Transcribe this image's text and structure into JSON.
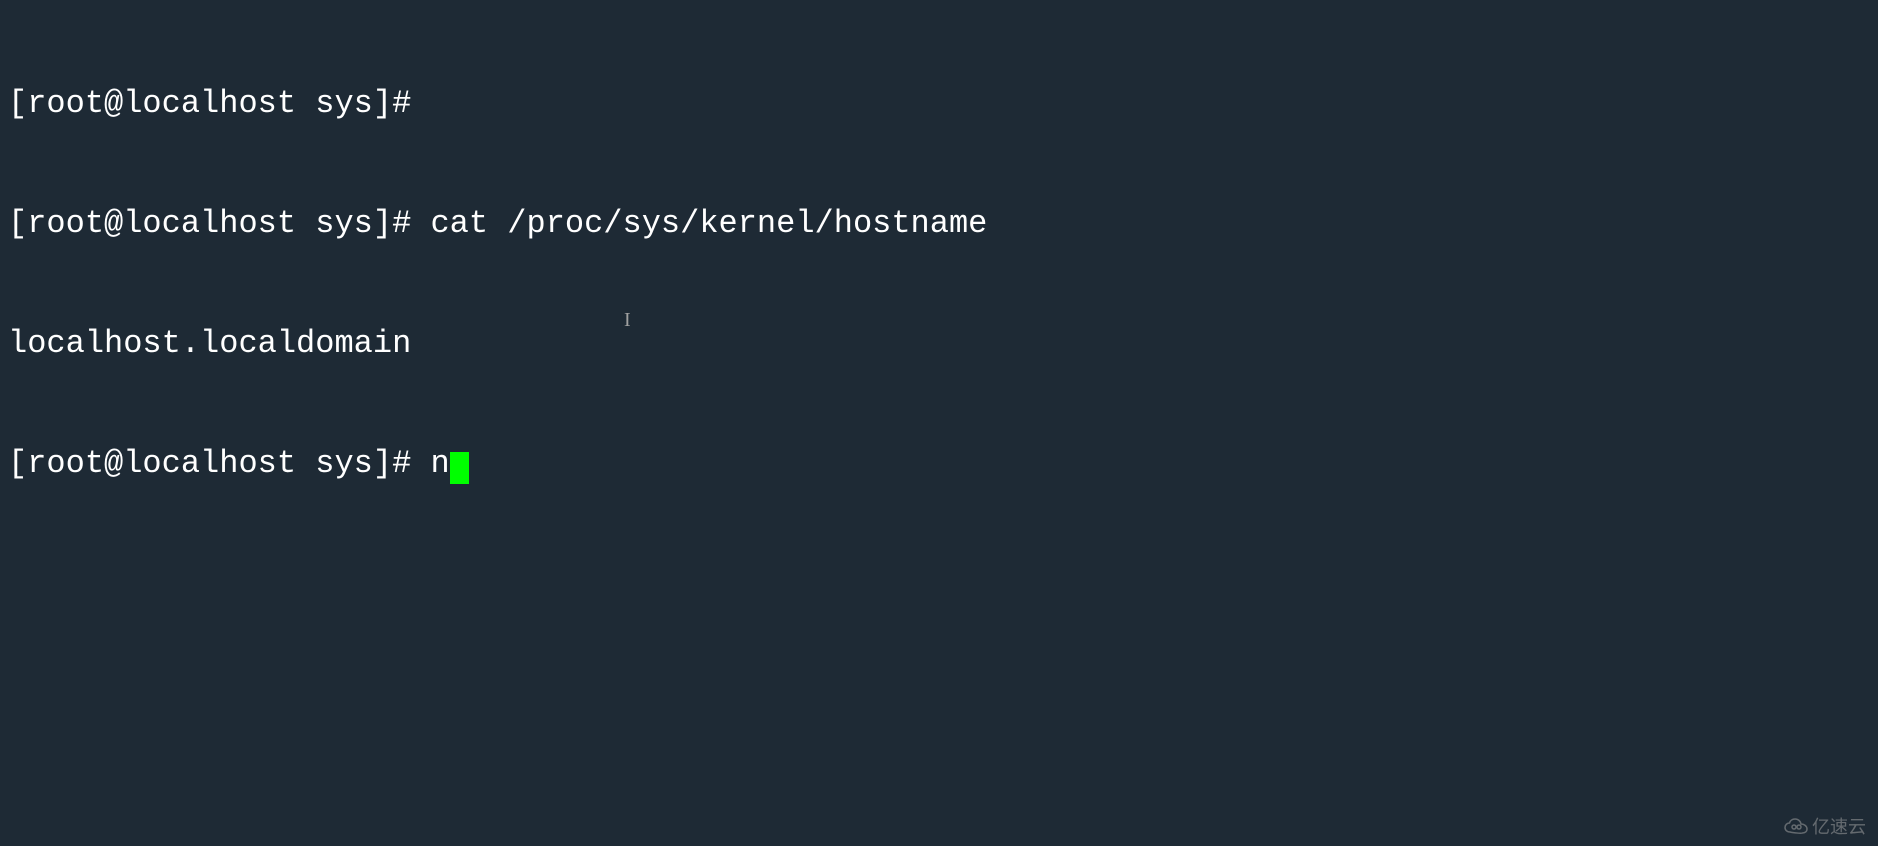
{
  "terminal": {
    "lines": [
      {
        "prompt": "[root@localhost sys]# ",
        "command": ""
      },
      {
        "prompt": "[root@localhost sys]# ",
        "command": "cat /proc/sys/kernel/hostname"
      },
      {
        "output": "localhost.localdomain"
      },
      {
        "prompt": "[root@localhost sys]# ",
        "command": "n",
        "cursor": true
      }
    ]
  },
  "watermark": {
    "text": "亿速云"
  }
}
